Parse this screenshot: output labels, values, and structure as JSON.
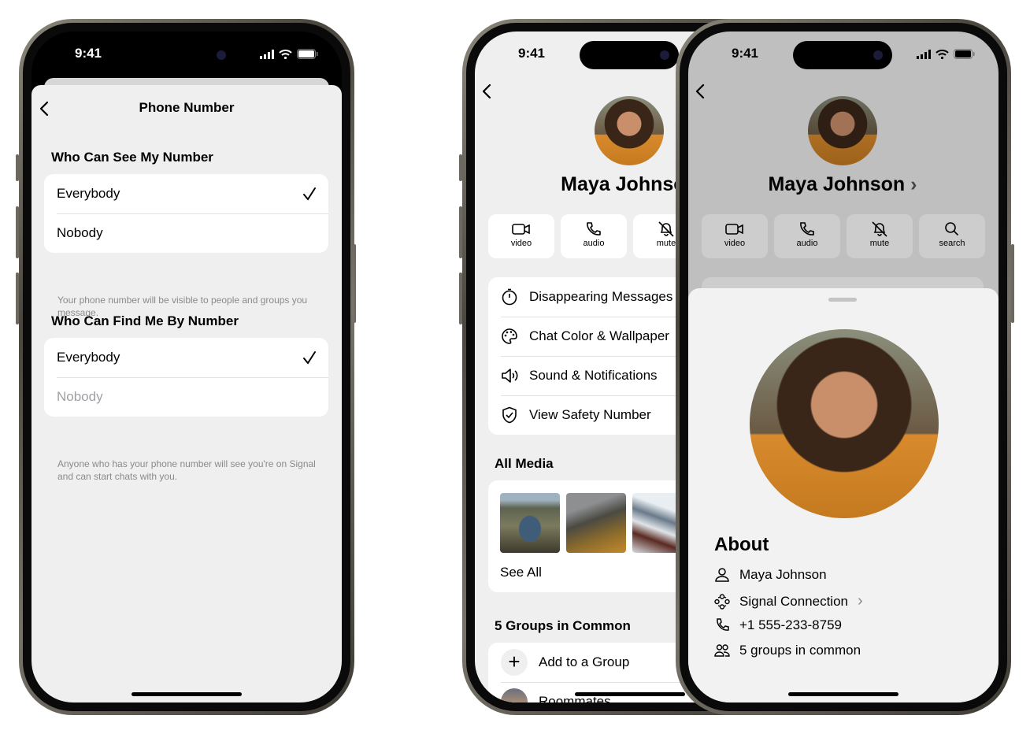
{
  "status_time": "9:41",
  "phone_number_screen": {
    "title": "Phone Number",
    "back_icon": "chevron-left-icon",
    "sections": [
      {
        "header": "Who Can See My Number",
        "options": [
          {
            "label": "Everybody",
            "selected": true
          },
          {
            "label": "Nobody",
            "selected": false
          }
        ],
        "footer": "Your phone number will be visible to people and groups you message."
      },
      {
        "header": "Who Can Find Me By Number",
        "options": [
          {
            "label": "Everybody",
            "selected": true
          },
          {
            "label": "Nobody",
            "selected": false,
            "disabled": true
          }
        ],
        "footer": "Anyone who has your phone number will see you're on Signal and can start chats with you."
      }
    ]
  },
  "contact_screen": {
    "name": "Maya Johnson",
    "actions": [
      {
        "label": "video",
        "icon": "video-icon"
      },
      {
        "label": "audio",
        "icon": "phone-icon"
      },
      {
        "label": "mute",
        "icon": "bell-slash-icon"
      },
      {
        "label": "search",
        "icon": "search-icon"
      }
    ],
    "settings": [
      {
        "label": "Disappearing Messages",
        "icon": "timer-icon"
      },
      {
        "label": "Chat Color & Wallpaper",
        "icon": "palette-icon"
      },
      {
        "label": "Sound & Notifications",
        "icon": "speaker-icon"
      },
      {
        "label": "View Safety Number",
        "icon": "shield-check-icon"
      }
    ],
    "media_header": "All Media",
    "see_all": "See All",
    "groups_header": "5 Groups in Common",
    "groups": [
      {
        "label": "Add to a Group"
      },
      {
        "label": "Roommates"
      }
    ]
  },
  "about_sheet": {
    "title": "About",
    "rows": [
      {
        "label": "Maya Johnson",
        "icon": "person-icon"
      },
      {
        "label": "Signal Connection",
        "icon": "connection-icon",
        "chevron": true
      },
      {
        "label": "+1 555-233-8759",
        "icon": "phone-icon"
      },
      {
        "label": "5 groups in common",
        "icon": "group-icon"
      }
    ]
  }
}
